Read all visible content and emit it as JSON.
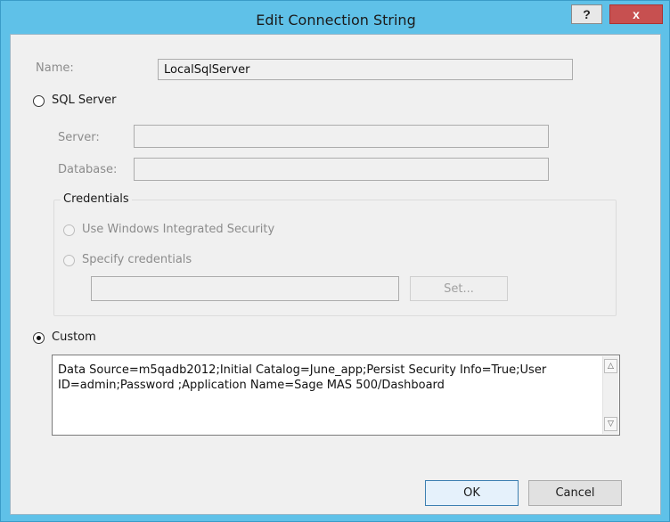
{
  "window": {
    "title": "Edit Connection String",
    "help_label": "?",
    "close_label": "x"
  },
  "form": {
    "name_label": "Name:",
    "name_value": "LocalSqlServer",
    "sql_server_label": "SQL Server",
    "server_label": "Server:",
    "server_value": "",
    "database_label": "Database:",
    "database_value": "",
    "credentials_label": "Credentials",
    "use_windows_label": "Use Windows Integrated Security",
    "specify_credentials_label": "Specify credentials",
    "credentials_value": "",
    "set_button_label": "Set...",
    "custom_label": "Custom",
    "custom_value": "Data Source=m5qadb2012;Initial Catalog=June_app;Persist Security Info=True;User ID=admin;Password ;Application Name=Sage MAS 500/Dashboard"
  },
  "selected_option": "custom",
  "buttons": {
    "ok_label": "OK",
    "cancel_label": "Cancel"
  }
}
